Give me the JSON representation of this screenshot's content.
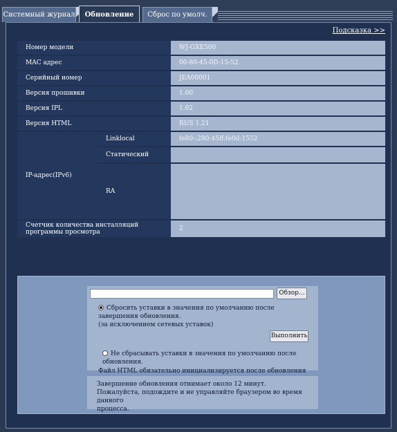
{
  "tabs": [
    {
      "label": "Системный журнал"
    },
    {
      "label": "Обновление"
    },
    {
      "label": "Сброс по умолч."
    }
  ],
  "help_link": "Подсказка >>",
  "info": {
    "model": {
      "label": "Номер модели",
      "value": "WJ-GXE500"
    },
    "mac": {
      "label": "MAC адрес",
      "value": "00-80-45-0D-15-52"
    },
    "serial": {
      "label": "Серийный номер",
      "value": "JEA00001"
    },
    "firmware": {
      "label": "Версия прошивки",
      "value": "1.00"
    },
    "ipl": {
      "label": "Версия IPL",
      "value": "1.02"
    },
    "html": {
      "label": "Версия HTML",
      "value": "RUS 1.21"
    },
    "ipv6": {
      "label": "IP-адрес(IPv6)",
      "linklocal": {
        "label": "Linklocal",
        "value": "fe80::280:45ff:fe0d:1552"
      },
      "static": {
        "label": "Статический",
        "value": ""
      },
      "ra": {
        "label": "RA",
        "value": ""
      }
    },
    "counter": {
      "label": "Счетчик количества инсталляций программы просмотра",
      "value": "2"
    }
  },
  "upgrade": {
    "browse_label": "Обзор...",
    "file_value": "",
    "option_reset_line1": "Сбросить уставки в значения по умолчанию после",
    "option_reset_line2": "завершения обновления.",
    "option_reset_line3": "(за исключением сетевых уставок)",
    "option_keep": "Не сбрасывать уставки в значения по умолчанию после обновления.",
    "execute_label": "Выполнить",
    "html_note": "Файл HTML обязательно инициализируется после обновления версии.",
    "selected_option": "reset"
  },
  "notice": {
    "line1": "Завершение обновления отнимает около 12 минут.",
    "line2": "Пожалуйста, подождите и не управляйте браузером во время данного",
    "line3": "процесса."
  },
  "colors": {
    "background": "#2a3a55",
    "label_cell": "#24385e",
    "value_cell": "#a6b6cf",
    "lower_panel": "#8098bd"
  },
  "icons": [
    "radio-button-icon"
  ]
}
